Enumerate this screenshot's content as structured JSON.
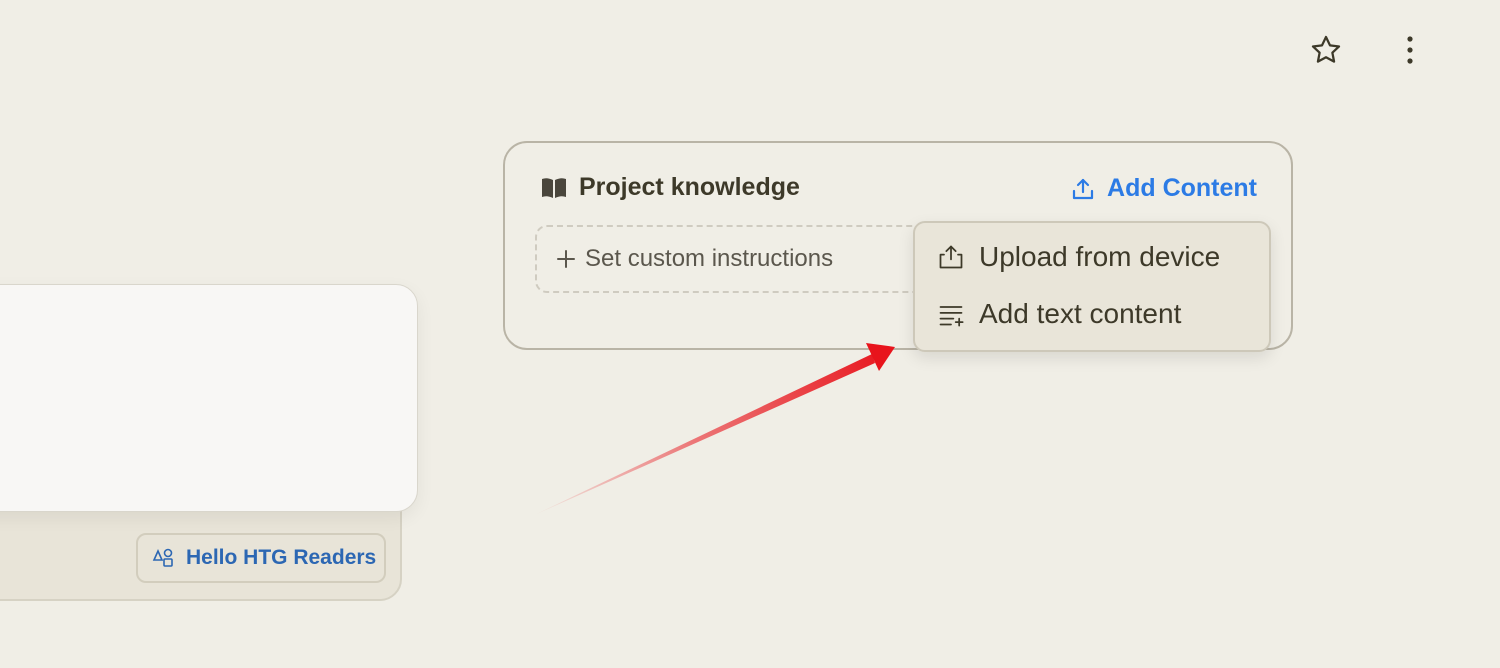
{
  "header": {
    "favorite_icon": "star-icon",
    "more_icon": "vertical-dots-icon"
  },
  "composer": {
    "style_chip_label": "Hello HTG Readers",
    "style_chip_icon": "shapes-icon"
  },
  "project_knowledge": {
    "title": "Project knowledge",
    "title_icon": "book-icon",
    "add_content_label": "Add Content",
    "add_content_icon": "upload-icon",
    "instructions_label": "Set custom instructions",
    "instructions_icon": "plus-icon"
  },
  "dropdown": {
    "items": [
      {
        "label": "Upload from device",
        "icon": "upload-tray-icon"
      },
      {
        "label": "Add text content",
        "icon": "list-add-icon"
      }
    ]
  },
  "colors": {
    "background": "#f0eee6",
    "accent": "#2c7be5",
    "chip_text": "#2c67b3",
    "annotation_arrow": "#e8141c"
  }
}
